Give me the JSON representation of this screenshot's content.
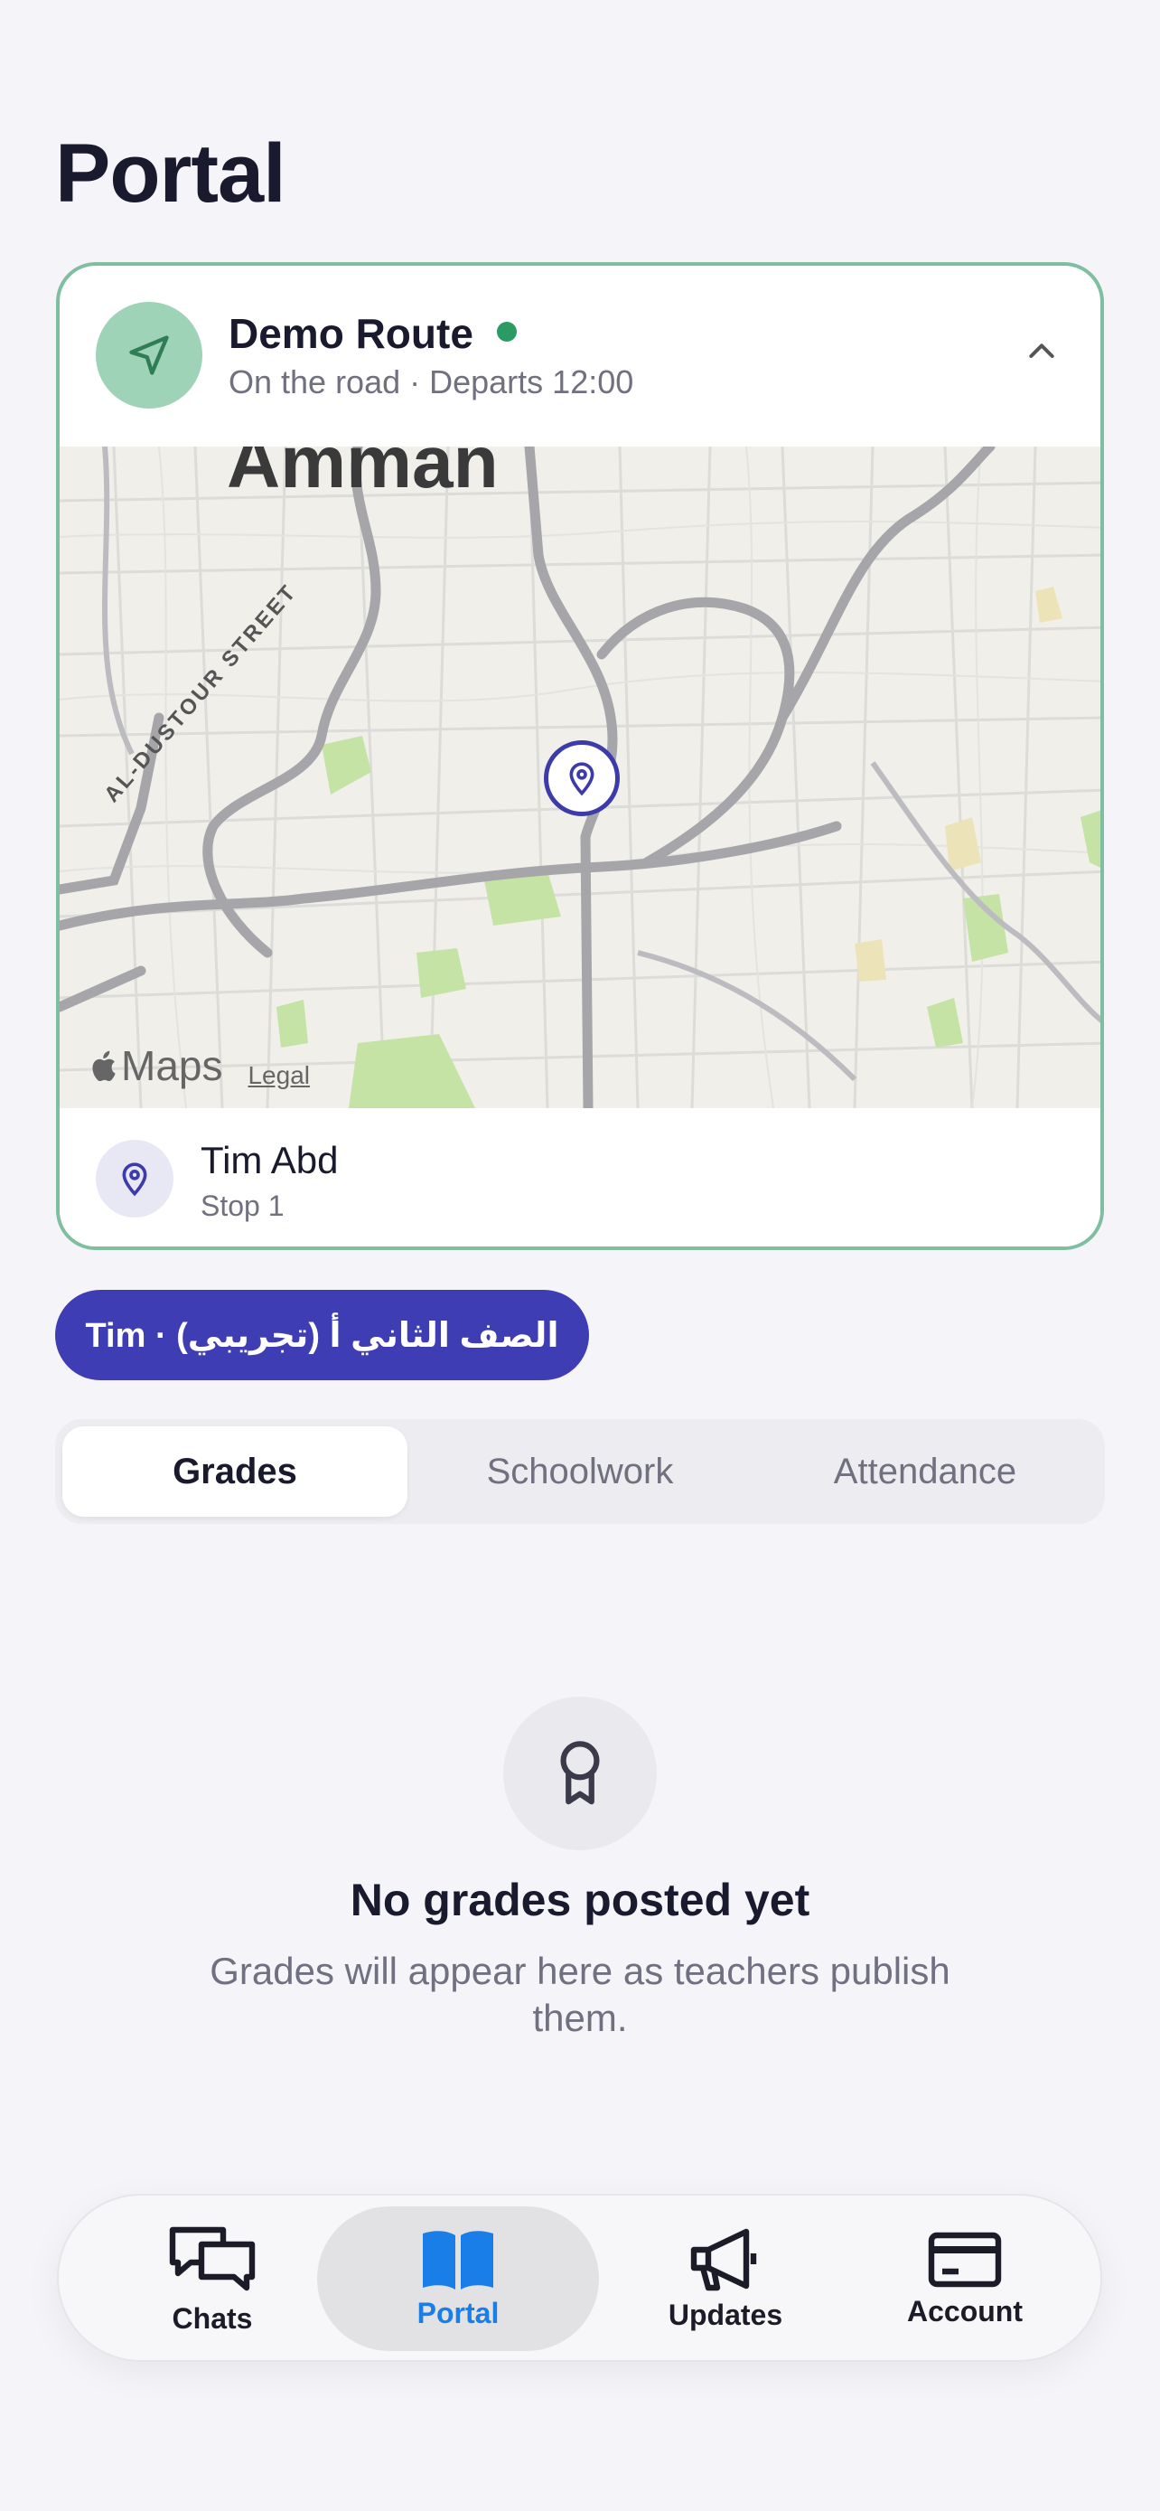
{
  "page": {
    "title": "Portal"
  },
  "route": {
    "name": "Demo Route",
    "status": "On the road · Departs 12:00",
    "status_color": "#2b9b63",
    "map": {
      "city_label": "Amman",
      "street_label": "AL-DUSTOUR STREET",
      "attribution": "Maps",
      "legal": "Legal"
    },
    "stop": {
      "name": "Tim Abd",
      "label": "Stop 1"
    }
  },
  "student": {
    "label": "Tim · الصف الثاني أ (تجريبي)",
    "color": "#3f3db3"
  },
  "tabs": [
    {
      "label": "Grades",
      "active": true
    },
    {
      "label": "Schoolwork",
      "active": false
    },
    {
      "label": "Attendance",
      "active": false
    }
  ],
  "empty_state": {
    "icon": "award-ribbon-icon",
    "title": "No grades posted yet",
    "text": "Grades will appear here as teachers publish them."
  },
  "nav": [
    {
      "label": "Chats",
      "icon": "chat-bubbles-icon",
      "active": false
    },
    {
      "label": "Portal",
      "icon": "book-open-icon",
      "active": true
    },
    {
      "label": "Updates",
      "icon": "megaphone-icon",
      "active": false
    },
    {
      "label": "Account",
      "icon": "card-icon",
      "active": false
    }
  ],
  "accent_color": "#1a7ee8"
}
